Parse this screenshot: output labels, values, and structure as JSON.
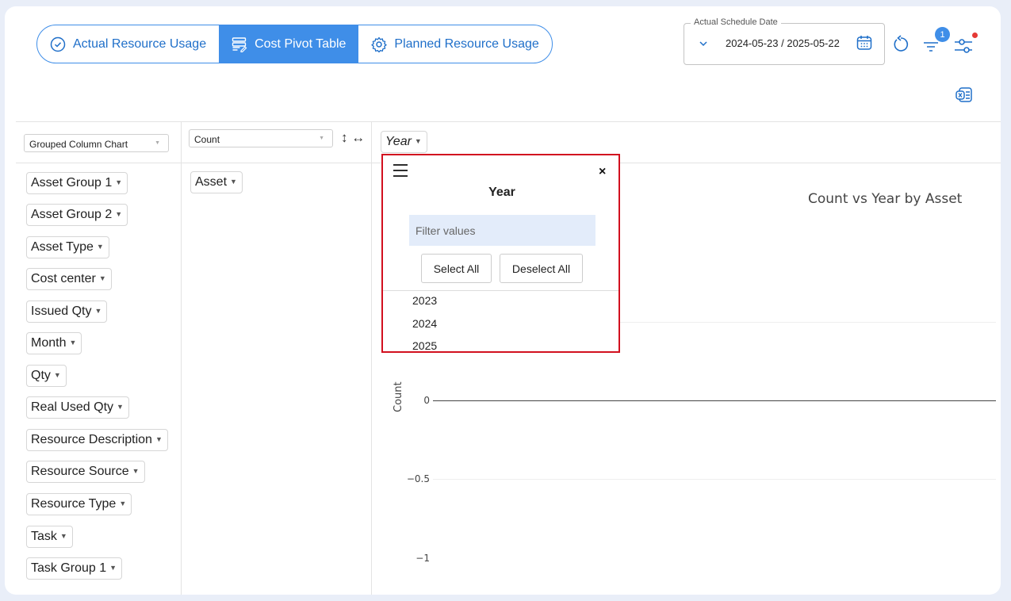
{
  "tabs": [
    {
      "label": "Actual Resource Usage",
      "icon": "check-circle-icon",
      "active": false
    },
    {
      "label": "Cost Pivot Table",
      "icon": "table-edit-icon",
      "active": true
    },
    {
      "label": "Planned Resource Usage",
      "icon": "gear-icon",
      "active": false
    }
  ],
  "date_filter": {
    "legend": "Actual Schedule Date",
    "value": "2024-05-23 / 2025-05-22"
  },
  "header": {
    "filter_badge": "1",
    "accent_color": "#3f8ee8"
  },
  "pivot": {
    "renderer": "Grouped Column Chart",
    "aggregator": "Count",
    "order_icons": "↕ ↔",
    "column_attrs": [
      "Year"
    ],
    "row_attrs": [
      "Asset"
    ],
    "unused_attrs": [
      "Asset Group 1",
      "Asset Group 2",
      "Asset Type",
      "Cost center",
      "Issued Qty",
      "Month",
      "Qty",
      "Real Used Qty",
      "Resource Description",
      "Resource Source",
      "Resource Type",
      "Task",
      "Task Group 1"
    ]
  },
  "filter_popup": {
    "title": "Year",
    "close": "×",
    "filter_placeholder": "Filter values",
    "select_all": "Select All",
    "deselect_all": "Deselect All",
    "values": [
      "2023",
      "2024",
      "2025"
    ]
  },
  "chart_data": {
    "type": "bar",
    "title": "Count vs Year by Asset",
    "xlabel": "",
    "ylabel": "Count",
    "y_ticks": [
      "0",
      "−0.5",
      "−1"
    ],
    "categories": [],
    "series": []
  }
}
